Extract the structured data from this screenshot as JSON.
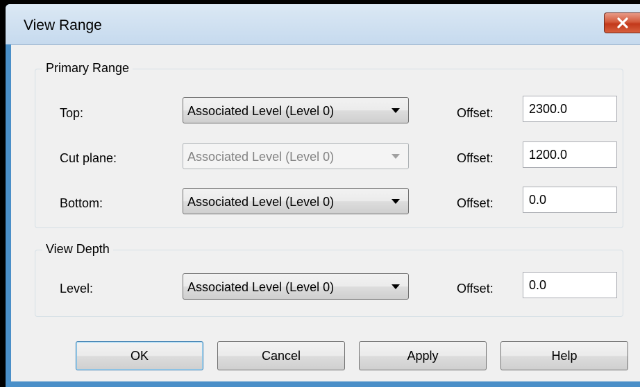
{
  "window": {
    "title": "View Range"
  },
  "primary_range": {
    "legend": "Primary Range",
    "rows": [
      {
        "label": "Top:",
        "level": "Associated Level (Level 0)",
        "enabled": true,
        "offset_label": "Offset:",
        "offset": "2300.0"
      },
      {
        "label": "Cut plane:",
        "level": "Associated Level (Level 0)",
        "enabled": false,
        "offset_label": "Offset:",
        "offset": "1200.0"
      },
      {
        "label": "Bottom:",
        "level": "Associated Level (Level 0)",
        "enabled": true,
        "offset_label": "Offset:",
        "offset": "0.0"
      }
    ]
  },
  "view_depth": {
    "legend": "View Depth",
    "row": {
      "label": "Level:",
      "level": "Associated Level (Level 0)",
      "offset_label": "Offset:",
      "offset": "0.0"
    }
  },
  "buttons": {
    "ok": "OK",
    "cancel": "Cancel",
    "apply": "Apply",
    "help": "Help"
  },
  "icons": {
    "close": "close-icon",
    "dropdown": "chevron-down-icon"
  },
  "colors": {
    "close_button": "#c7432a",
    "window_frame": "#4a8fc8",
    "dialog_bg": "#f0f0f0"
  }
}
